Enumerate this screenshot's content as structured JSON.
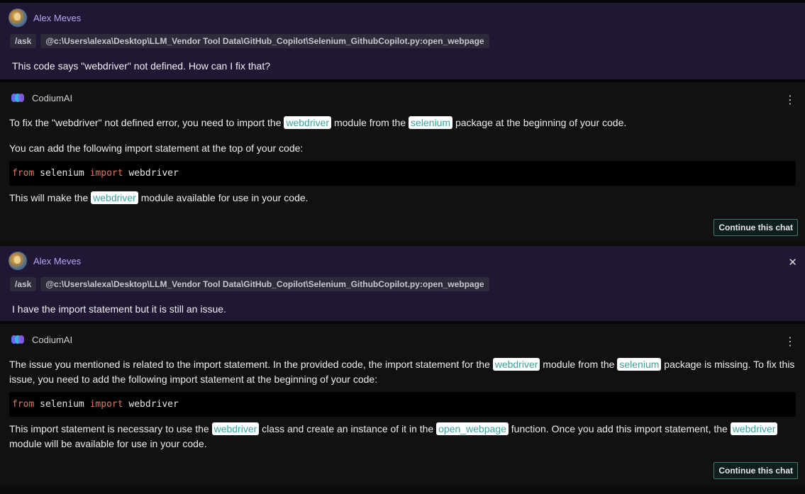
{
  "messages": {
    "user1": {
      "name": "Alex Meves",
      "command": "/ask",
      "context": "@c:\\Users\\alexa\\Desktop\\LLM_Vendor Tool Data\\GitHub_Copilot\\Selenium_GithubCopilot.py:open_webpage",
      "text": "This code says \"webdriver\" not defined.  How can I fix that?"
    },
    "ai1": {
      "name": "CodiumAI",
      "p1_a": "To fix the \"webdriver\" not defined error, you need to import the",
      "p1_code1": "webdriver",
      "p1_b": "module from the",
      "p1_code2": "selenium",
      "p1_c": "package at the beginning of your code.",
      "p2": "You can add the following import statement at the top of your code:",
      "code_from": "from",
      "code_module": " selenium ",
      "code_import": "import",
      "code_name": " webdriver",
      "p3_a": "This will make the",
      "p3_code": "webdriver",
      "p3_b": "module available for use in your code.",
      "continue_label": "Continue this chat"
    },
    "user2": {
      "name": "Alex Meves",
      "command": "/ask",
      "context": "@c:\\Users\\alexa\\Desktop\\LLM_Vendor Tool Data\\GitHub_Copilot\\Selenium_GithubCopilot.py:open_webpage",
      "text": "I have the import statement but it is still an issue.",
      "close_glyph": "✕"
    },
    "ai2": {
      "name": "CodiumAI",
      "p1_a": "The issue you mentioned is related to the import statement. In the provided code, the import statement for the",
      "p1_code1": "webdriver",
      "p1_b": "module from the",
      "p1_code2": "selenium",
      "p1_c": "package is missing. To fix this issue, you need to add the following import statement at the beginning of your code:",
      "code_from": "from",
      "code_module": " selenium ",
      "code_import": "import",
      "code_name": " webdriver",
      "p2_a": "This import statement is necessary to use the",
      "p2_code1": "webdriver",
      "p2_b": "class and create an instance of it in the",
      "p2_code2": "open_webpage",
      "p2_c": "function. Once you add this import statement, the",
      "p2_code3": "webdriver",
      "p2_d": "module will be available for use in your code.",
      "continue_label": "Continue this chat"
    }
  },
  "icons": {
    "kebab": "⋮",
    "avatar": "user-avatar",
    "codium": "codium-logo"
  },
  "colors": {
    "user_bg": "#1f1734",
    "ai_bg": "#111111",
    "inline_code_text": "#3aa39a",
    "keyword": "#e07a5f",
    "user_name": "#b9a6f2",
    "button_border": "#3d7a72"
  }
}
